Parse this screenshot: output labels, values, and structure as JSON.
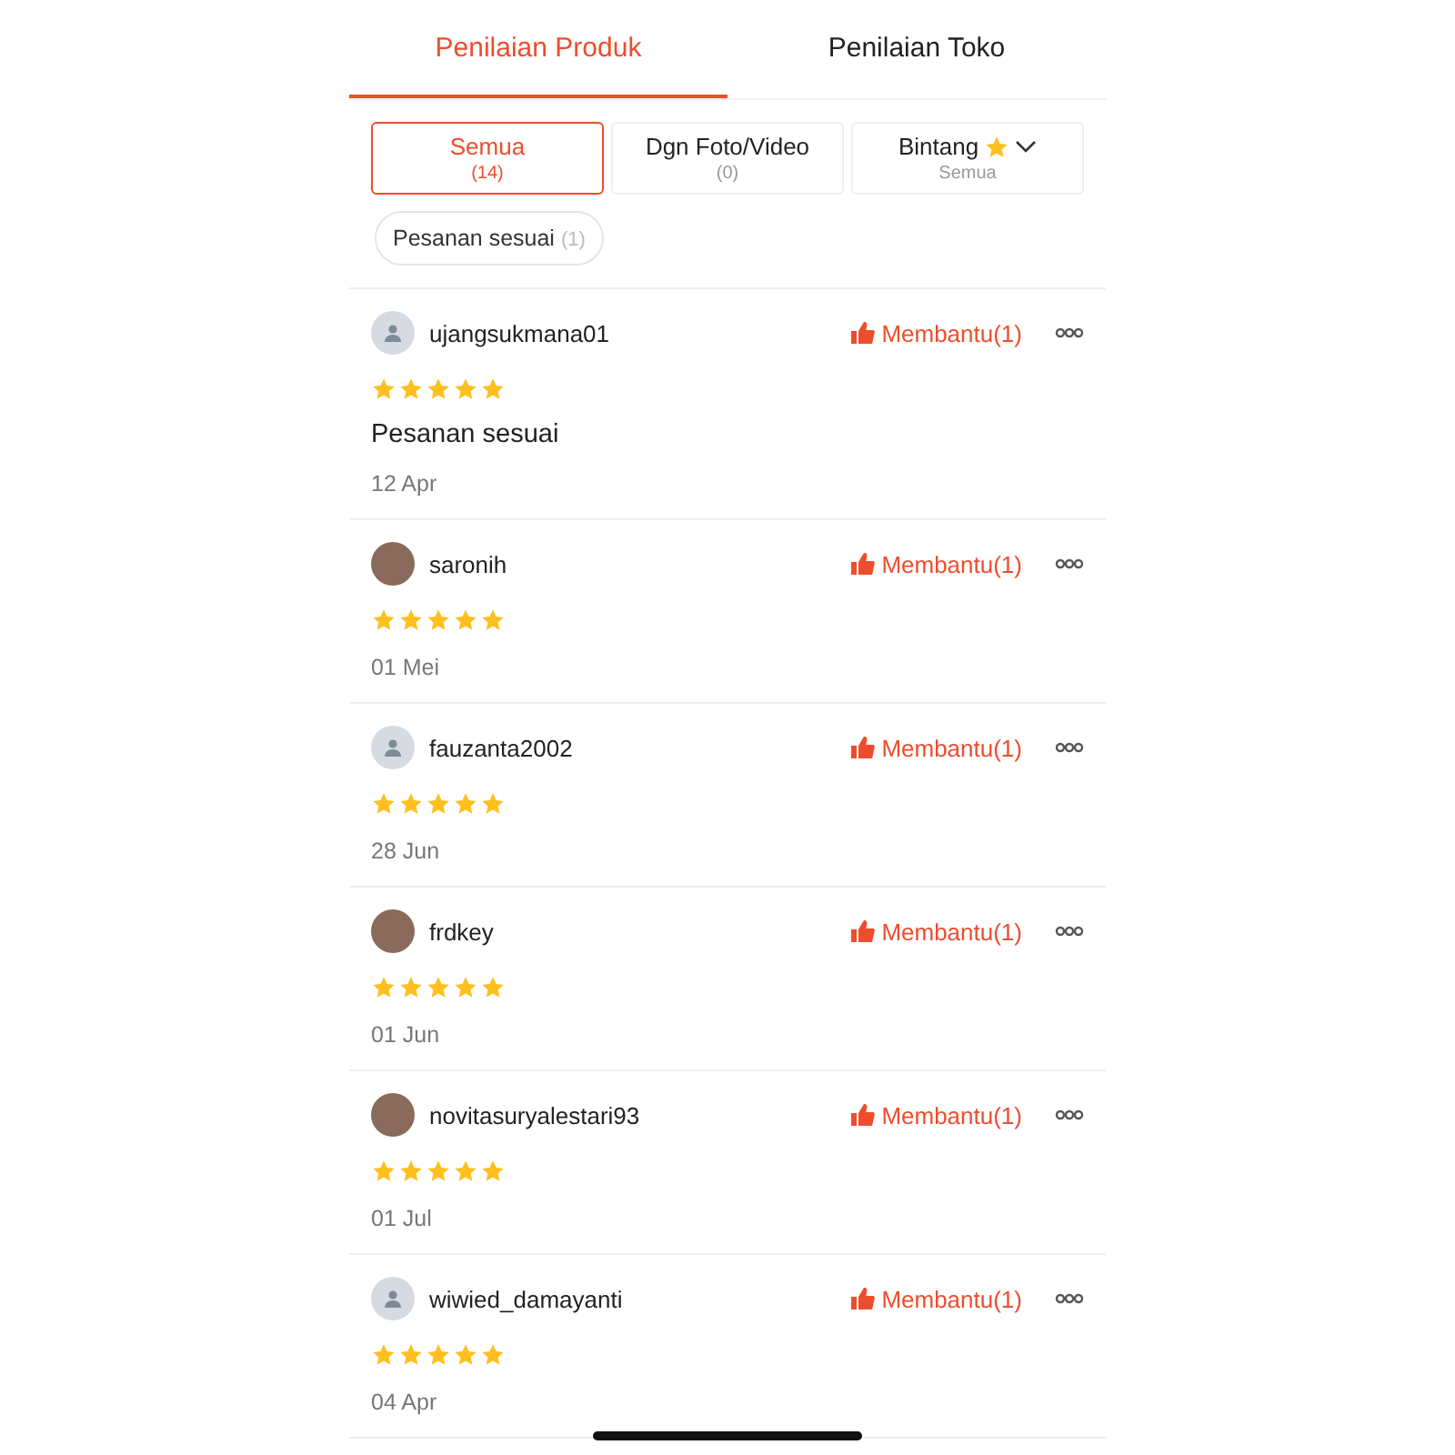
{
  "tabs": [
    {
      "label": "Penilaian Produk",
      "selected": true
    },
    {
      "label": "Penilaian Toko",
      "selected": false
    }
  ],
  "filters": [
    {
      "label": "Semua",
      "sub": "(14)",
      "selected": true,
      "kind": "count"
    },
    {
      "label": "Dgn Foto/Video",
      "sub": "(0)",
      "selected": false,
      "kind": "count"
    },
    {
      "label": "Bintang",
      "sub": "Semua",
      "selected": false,
      "kind": "stars"
    }
  ],
  "chips": [
    {
      "label": "Pesanan sesuai",
      "count": "(1)",
      "selected": false
    }
  ],
  "reviews": [
    {
      "user": "ujangsukmana01",
      "kind": "default",
      "helpful": "Membantu(1)",
      "stars": 5,
      "text": "Pesanan sesuai",
      "date": "12 Apr"
    },
    {
      "user": "saronih",
      "kind": "photo",
      "helpful": "Membantu(1)",
      "stars": 5,
      "date": "01 Mei"
    },
    {
      "user": "fauzanta2002",
      "kind": "default",
      "helpful": "Membantu(1)",
      "stars": 5,
      "date": "28 Jun"
    },
    {
      "user": "frdkey",
      "kind": "photo",
      "helpful": "Membantu(1)",
      "stars": 5,
      "date": "01 Jun"
    },
    {
      "user": "novitasuryalestari93",
      "kind": "photo",
      "helpful": "Membantu(1)",
      "stars": 5,
      "date": "01 Jul"
    },
    {
      "user": "wiwied_damayanti",
      "kind": "default",
      "helpful": "Membantu(1)",
      "stars": 5,
      "date": "04 Apr"
    }
  ]
}
